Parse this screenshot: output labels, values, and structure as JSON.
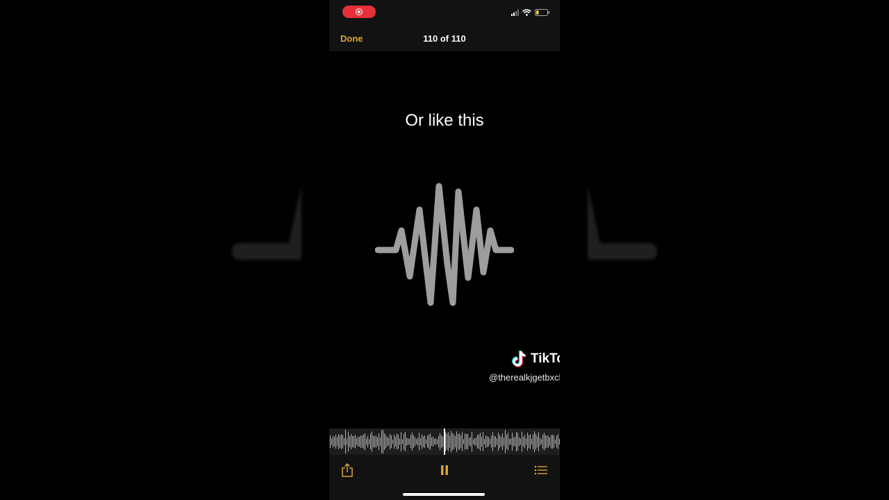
{
  "status_bar": {
    "recording_indicator_color": "#e5303a"
  },
  "header": {
    "done_label": "Done",
    "counter": "110 of 110",
    "accent_color": "#d9a533"
  },
  "content": {
    "caption": "Or like this",
    "graphic": "sound-wave-icon"
  },
  "watermark": {
    "brand": "TikTok",
    "handle": "@therealkjgetbxcks"
  },
  "playback": {
    "position": 0.5,
    "state": "playing"
  },
  "toolbar": {
    "items": [
      "share-icon",
      "pause-icon",
      "list-icon"
    ]
  }
}
